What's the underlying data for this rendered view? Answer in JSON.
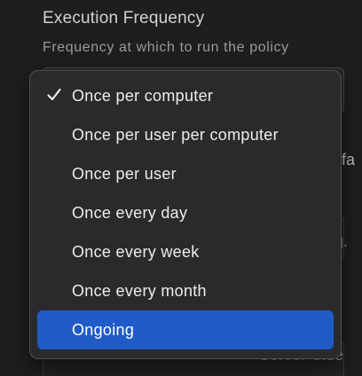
{
  "field": {
    "title": "Execution Frequency",
    "help": "Frequency at which to run the policy"
  },
  "background_fragments": {
    "frag_1": "n fa",
    "frag_2": ".g.",
    "frag_3": "Server-Side"
  },
  "dropdown": {
    "selected": "Once per computer",
    "highlighted": "Ongoing",
    "options": [
      {
        "label": "Once per computer",
        "checked": true
      },
      {
        "label": "Once per user per computer",
        "checked": false
      },
      {
        "label": "Once per user",
        "checked": false
      },
      {
        "label": "Once every day",
        "checked": false
      },
      {
        "label": "Once every week",
        "checked": false
      },
      {
        "label": "Once every month",
        "checked": false
      },
      {
        "label": "Ongoing",
        "checked": false
      }
    ]
  },
  "colors": {
    "highlight": "#1f5bc6",
    "menu_bg": "#2a2a2c",
    "page_bg": "#1e1e1e"
  },
  "icons": {
    "check": "checkmark-icon"
  }
}
